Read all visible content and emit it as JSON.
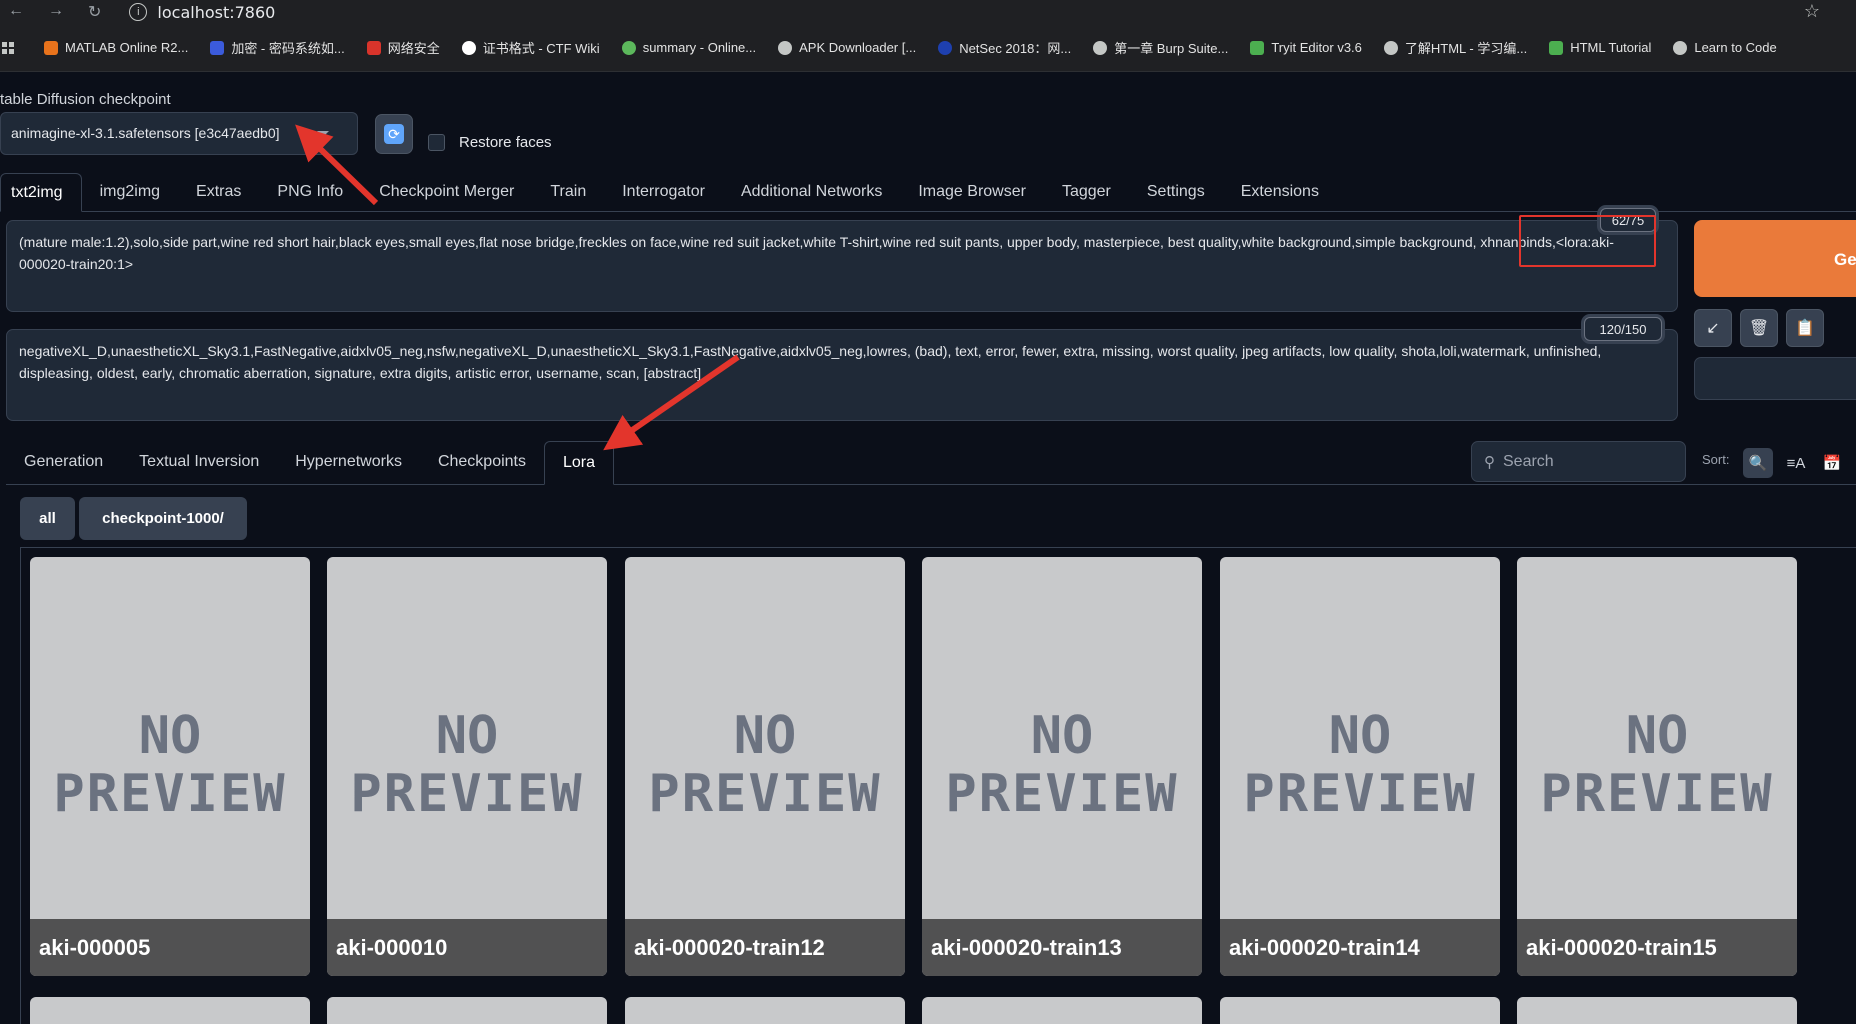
{
  "browser": {
    "url": "localhost:7860",
    "bookmarks": [
      {
        "label": "MATLAB Online R2...",
        "color": "#e8731c"
      },
      {
        "label": "加密 - 密码系统如...",
        "color": "#3b5bdb"
      },
      {
        "label": "网络安全",
        "color": "#d9342b"
      },
      {
        "label": "证书格式 - CTF Wiki",
        "color": "#ffffff"
      },
      {
        "label": "summary - Online...",
        "color": "#5cb85c"
      },
      {
        "label": "APK Downloader [...",
        "color": "#c4c7c5"
      },
      {
        "label": "NetSec 2018：网...",
        "color": "#1e40af"
      },
      {
        "label": "第一章 Burp Suite...",
        "color": "#c4c7c5"
      },
      {
        "label": "Tryit Editor v3.6",
        "color": "#4caf50"
      },
      {
        "label": "了解HTML - 学习编...",
        "color": "#c4c7c5"
      },
      {
        "label": "HTML Tutorial",
        "color": "#4caf50"
      },
      {
        "label": "Learn to Code",
        "color": "#c4c7c5"
      }
    ]
  },
  "checkpoint": {
    "label": "table Diffusion checkpoint",
    "value": "animagine-xl-3.1.safetensors [e3c47aedb0]",
    "restore_faces": "Restore faces"
  },
  "main_tabs": [
    "txt2img",
    "img2img",
    "Extras",
    "PNG Info",
    "Checkpoint Merger",
    "Train",
    "Interrogator",
    "Additional Networks",
    "Image Browser",
    "Tagger",
    "Settings",
    "Extensions"
  ],
  "prompt": {
    "positive": "(mature male:1.2),solo,side part,wine red short hair,black eyes,small eyes,flat nose bridge,freckles on face,wine red suit jacket,white T-shirt,wine red suit pants, upper body, masterpiece, best quality,white background,simple background, xhnanpinds,<lora:aki-000020-train20:1>",
    "positive_counter": "62/75",
    "negative": "negativeXL_D,unaestheticXL_Sky3.1,FastNegative,aidxlv05_neg,nsfw,negativeXL_D,unaestheticXL_Sky3.1,FastNegative,aidxlv05_neg,lowres, (bad), text, error, fewer, extra, missing, worst quality, jpeg artifacts, low quality, shota,loli,watermark, unfinished, displeasing, oldest, early, chromatic aberration, signature, extra digits, artistic error, username, scan, [abstract]",
    "negative_counter": "120/150"
  },
  "generate_label": "Ge",
  "extra_tabs": [
    "Generation",
    "Textual Inversion",
    "Hypernetworks",
    "Checkpoints",
    "Lora"
  ],
  "search_placeholder": "Search",
  "sort_label": "Sort:",
  "filters": [
    "all",
    "checkpoint-1000/"
  ],
  "no_preview": {
    "line1": "NO",
    "line2": "PREVIEW"
  },
  "cards": [
    "aki-000005",
    "aki-000010",
    "aki-000020-train12",
    "aki-000020-train13",
    "aki-000020-train14",
    "aki-000020-train15"
  ],
  "colors": {
    "accent": "#ea7a3a",
    "annotation": "#e3352c",
    "background": "#0b0f19"
  }
}
